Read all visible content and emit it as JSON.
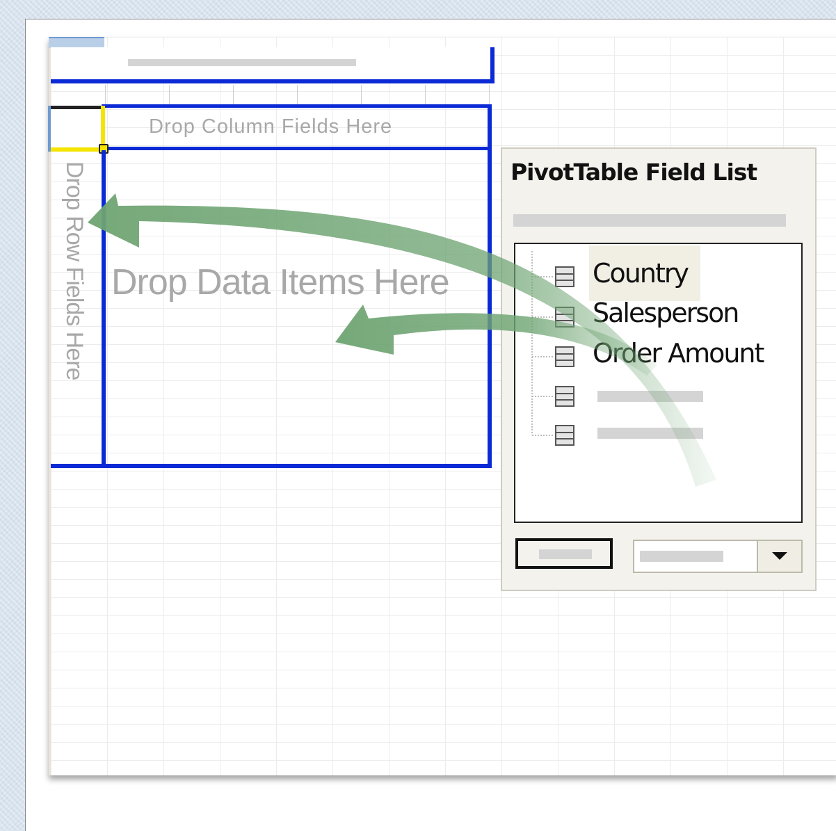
{
  "pivot_layout": {
    "column_drop_label": "Drop Column Fields Here",
    "row_drop_label": "Drop Row Fields Here",
    "data_drop_label": "Drop Data Items Here"
  },
  "field_list": {
    "title": "PivotTable Field List",
    "fields": [
      {
        "label": "Country"
      },
      {
        "label": "Salesperson"
      },
      {
        "label": "Order Amount"
      },
      {
        "label": ""
      },
      {
        "label": ""
      }
    ]
  },
  "icons": [
    "field-icon",
    "dropdown-arrow-icon",
    "drag-arrow-icon"
  ],
  "colors": {
    "drop_zone_border": "#0b2ad6",
    "active_cell_border": "#f5e400",
    "drag_arrow": "#6ea472",
    "panel_bg": "#f4f2ec"
  }
}
